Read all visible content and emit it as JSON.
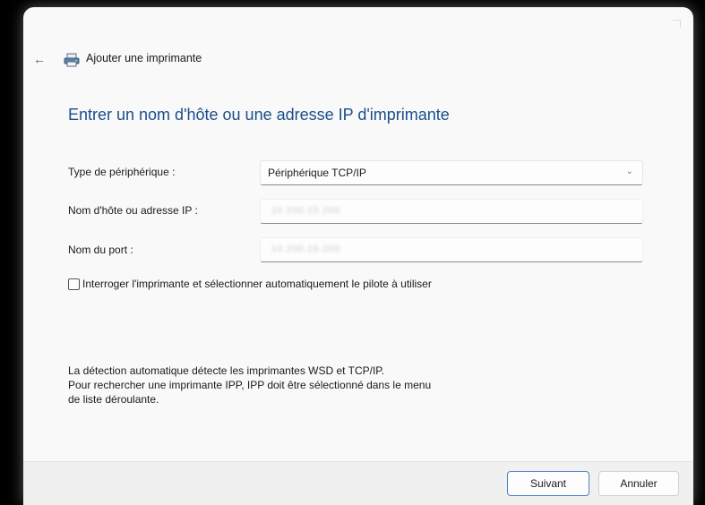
{
  "window": {
    "title": "Ajouter une imprimante",
    "back_glyph": "←"
  },
  "main": {
    "heading": "Entrer un nom d'hôte ou une adresse IP d'imprimante",
    "device_type": {
      "label": "Type de périphérique :",
      "selected": "Périphérique TCP/IP"
    },
    "hostname": {
      "label": "Nom d'hôte ou adresse IP :",
      "value": "10.200.15.200"
    },
    "port": {
      "label": "Nom du port :",
      "value": "10.200.15.200"
    },
    "autodetect": {
      "label": "Interroger l'imprimante et sélectionner automatiquement le pilote à utiliser",
      "checked": false
    },
    "info_lines": [
      "La détection automatique détecte les imprimantes WSD et TCP/IP.",
      "Pour rechercher une imprimante IPP, IPP doit être sélectionné dans le menu",
      "de liste déroulante."
    ]
  },
  "footer": {
    "next_label": "Suivant",
    "cancel_label": "Annuler"
  },
  "colors": {
    "heading": "#1a4e8a",
    "accent_border": "#4a80c8",
    "window_bg": "#f9f9f9"
  }
}
